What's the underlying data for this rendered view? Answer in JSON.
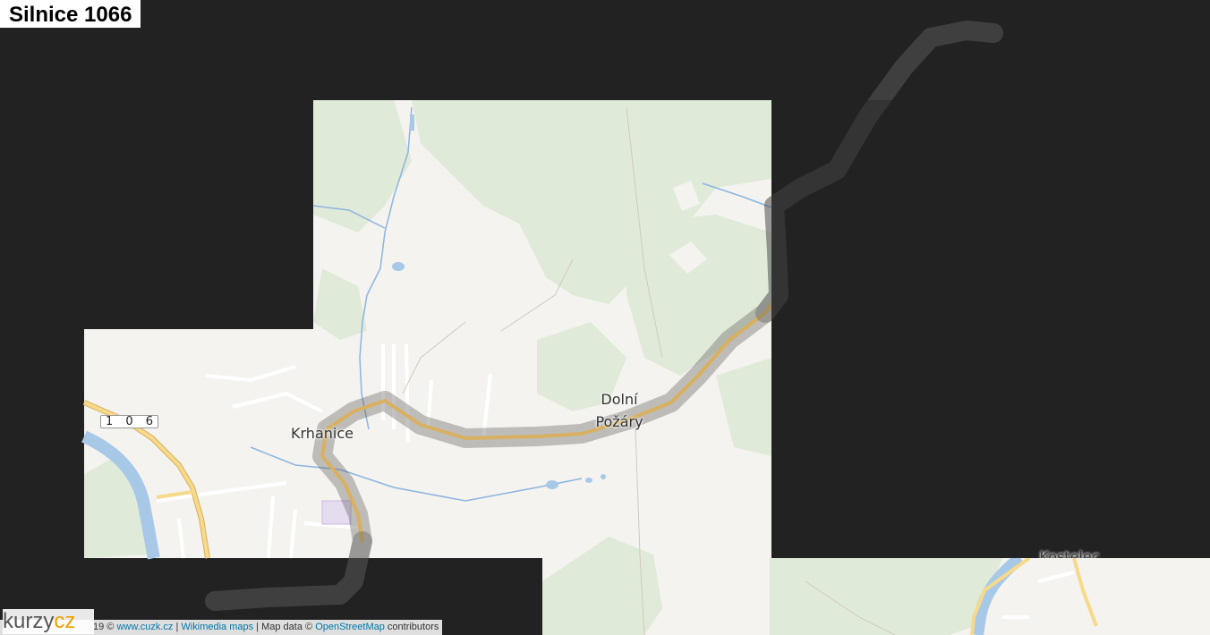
{
  "title": "Silnice 1066",
  "map": {
    "places": [
      {
        "name": "Krhanice"
      },
      {
        "name_line1": "Dolní",
        "name_line2": "Požáry"
      },
      {
        "name": "Kostelec"
      }
    ],
    "road_shield": "1 0 6",
    "colors": {
      "background": "#222222",
      "land": "#f4f3ef",
      "forest": "#dfe9d6",
      "water": "#a8c8e8",
      "road_major": "#f5cc70",
      "route_highlight": "#777777",
      "accent": "#0078a8"
    }
  },
  "attribution": {
    "prefix": "19 ©",
    "link1": "www.cuzk.cz",
    "sep1": "|",
    "link2": "Wikimedia maps",
    "middle": "| Map data ©",
    "link3": "OpenStreetMap",
    "suffix": "contributors"
  },
  "logo": {
    "part1": "kurzy",
    "part2": "cz"
  }
}
